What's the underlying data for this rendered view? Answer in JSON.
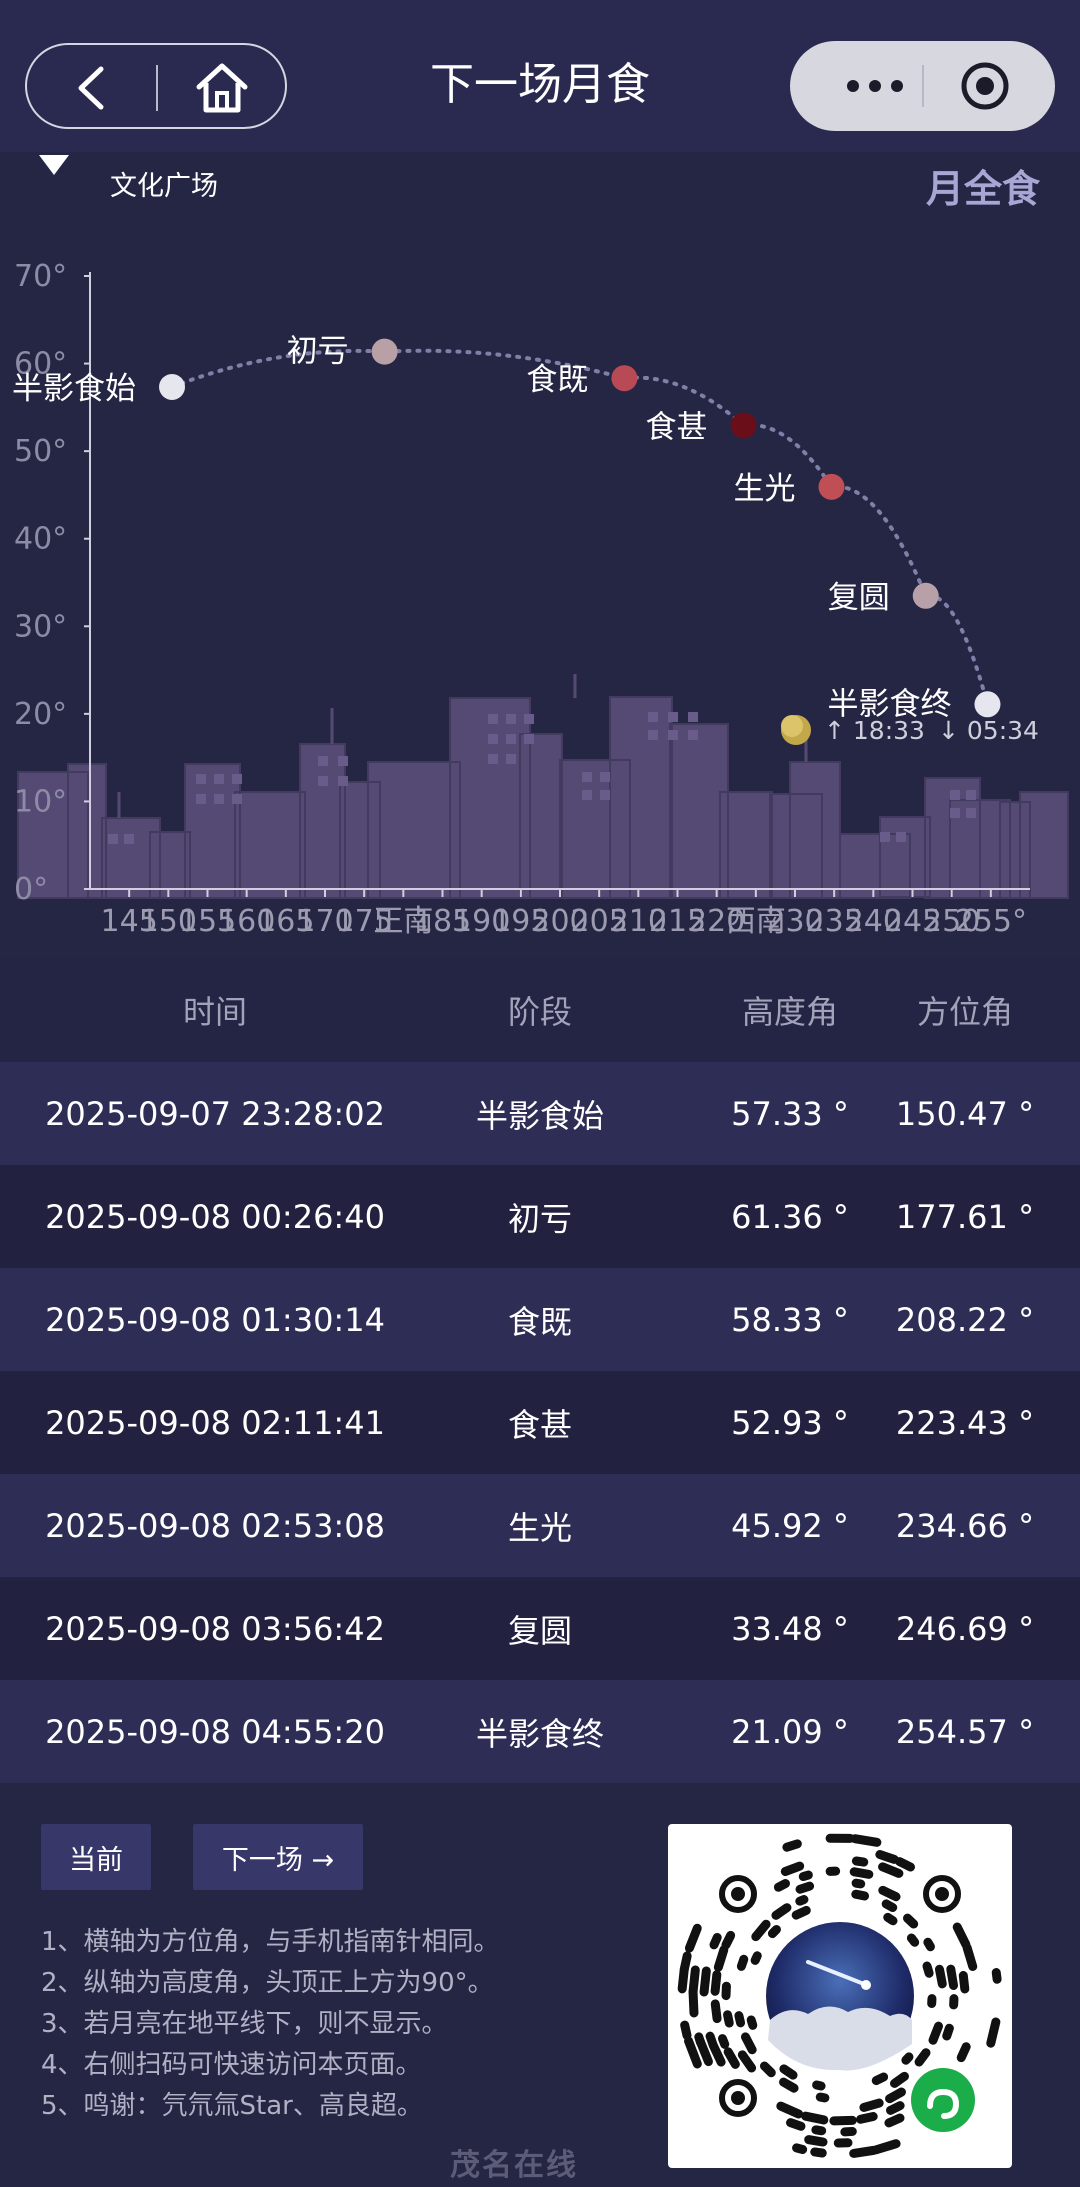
{
  "nav": {
    "title": "下一场月食"
  },
  "header": {
    "location": "文化广场",
    "eclipse_type": "月全食"
  },
  "chart_data": {
    "type": "scatter",
    "title": "",
    "xlabel": "方位角",
    "ylabel": "高度角",
    "xlim": [
      140,
      260
    ],
    "ylim": [
      0,
      70
    ],
    "yticks": [
      "0°",
      "10°",
      "20°",
      "30°",
      "40°",
      "50°",
      "60°",
      "70°"
    ],
    "xticks": [
      "145",
      "150",
      "155",
      "160",
      "165",
      "170",
      "175",
      "正南",
      "185",
      "190",
      "195",
      "200",
      "205",
      "210",
      "215",
      "220",
      "西南",
      "230",
      "235",
      "240",
      "245",
      "250",
      "255°"
    ],
    "points": [
      {
        "label": "半影食始",
        "x": 150.47,
        "y": 57.33,
        "color": "#e6e6ee"
      },
      {
        "label": "初亏",
        "x": 177.61,
        "y": 61.36,
        "color": "#b9a0a6"
      },
      {
        "label": "食既",
        "x": 208.22,
        "y": 58.33,
        "color": "#b84a55"
      },
      {
        "label": "食甚",
        "x": 223.43,
        "y": 52.93,
        "color": "#6a0e1a"
      },
      {
        "label": "生光",
        "x": 234.66,
        "y": 45.92,
        "color": "#c04e55"
      },
      {
        "label": "复圆",
        "x": 246.69,
        "y": 33.48,
        "color": "#b7a0a8"
      },
      {
        "label": "半影食终",
        "x": 254.57,
        "y": 21.09,
        "color": "#e6e6ee"
      }
    ],
    "moon": {
      "rise": "↑ 18:33",
      "set": "↓ 05:34"
    },
    "grid": false,
    "legend": "none"
  },
  "table": {
    "headers": [
      "时间",
      "阶段",
      "高度角",
      "方位角"
    ],
    "rows": [
      [
        "2025-09-07 23:28:02",
        "半影食始",
        "57.33 °",
        "150.47 °"
      ],
      [
        "2025-09-08 00:26:40",
        "初亏",
        "61.36 °",
        "177.61 °"
      ],
      [
        "2025-09-08 01:30:14",
        "食既",
        "58.33 °",
        "208.22 °"
      ],
      [
        "2025-09-08 02:11:41",
        "食甚",
        "52.93 °",
        "223.43 °"
      ],
      [
        "2025-09-08 02:53:08",
        "生光",
        "45.92 °",
        "234.66 °"
      ],
      [
        "2025-09-08 03:56:42",
        "复圆",
        "33.48 °",
        "246.69 °"
      ],
      [
        "2025-09-08 04:55:20",
        "半影食终",
        "21.09 °",
        "254.57 °"
      ]
    ]
  },
  "buttons": {
    "now": "当前",
    "next": "下一场 →"
  },
  "notes": [
    "1、横轴为方位角，与手机指南针相同。",
    "2、纵轴为高度角，头顶正上方为90°。",
    "3、若月亮在地平线下，则不显示。",
    "4、右侧扫码可快速访问本页面。",
    "5、鸣谢：氕氘氚Star、高良超。"
  ],
  "watermark": "茂名在线",
  "colors": {
    "background": "#252644",
    "navbar": "#2a2a50",
    "row_odd": "#2e2d56",
    "row_even": "#222240",
    "buildings": "#554a74",
    "accent": "#a7a6d4"
  }
}
